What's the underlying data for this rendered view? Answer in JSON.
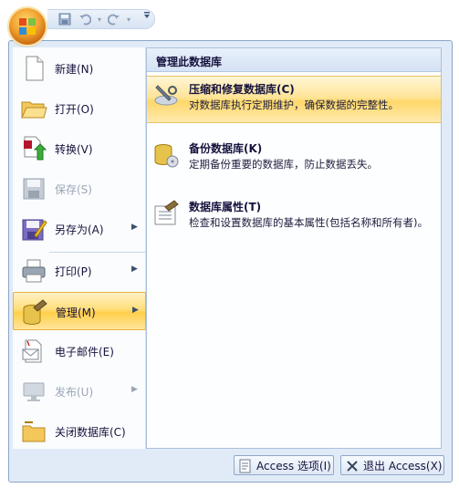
{
  "qat": {
    "save_icon": "save-icon",
    "undo_icon": "undo-icon",
    "redo_icon": "redo-icon",
    "customize_icon": "customize-qat-icon"
  },
  "menu": {
    "items": [
      {
        "label": "新建(N)",
        "icon": "new-document-icon",
        "enabled": true,
        "submenu": false
      },
      {
        "label": "打开(O)",
        "icon": "open-folder-icon",
        "enabled": true,
        "submenu": false
      },
      {
        "label": "转换(V)",
        "icon": "convert-icon",
        "enabled": true,
        "submenu": false
      },
      {
        "label": "保存(S)",
        "icon": "save-icon",
        "enabled": false,
        "submenu": false
      },
      {
        "label": "另存为(A)",
        "icon": "save-as-icon",
        "enabled": true,
        "submenu": true
      },
      {
        "label": "打印(P)",
        "icon": "printer-icon",
        "enabled": true,
        "submenu": true
      },
      {
        "label": "管理(M)",
        "icon": "manage-icon",
        "enabled": true,
        "submenu": true,
        "active": true
      },
      {
        "label": "电子邮件(E)",
        "icon": "email-icon",
        "enabled": true,
        "submenu": false
      },
      {
        "label": "发布(U)",
        "icon": "publish-icon",
        "enabled": false,
        "submenu": true
      },
      {
        "label": "关闭数据库(C)",
        "icon": "close-database-icon",
        "enabled": true,
        "submenu": false
      }
    ]
  },
  "pane": {
    "title": "管理此数据库",
    "options": [
      {
        "title": "压缩和修复数据库(C)",
        "desc": "对数据库执行定期维护，确保数据的完整性。",
        "icon": "compact-repair-icon",
        "highlighted": true
      },
      {
        "title": "备份数据库(K)",
        "desc": "定期备份重要的数据库，防止数据丢失。",
        "icon": "backup-database-icon",
        "highlighted": false
      },
      {
        "title": "数据库属性(T)",
        "desc": "检查和设置数据库的基本属性(包括名称和所有者)。",
        "icon": "database-properties-icon",
        "highlighted": false
      }
    ]
  },
  "footer": {
    "options_label": "Access 选项(I)",
    "exit_label": "退出 Access(X)"
  },
  "colors": {
    "frame_bg": "#e1ebf7",
    "highlight": "#ffd86a",
    "text": "#15133d"
  }
}
